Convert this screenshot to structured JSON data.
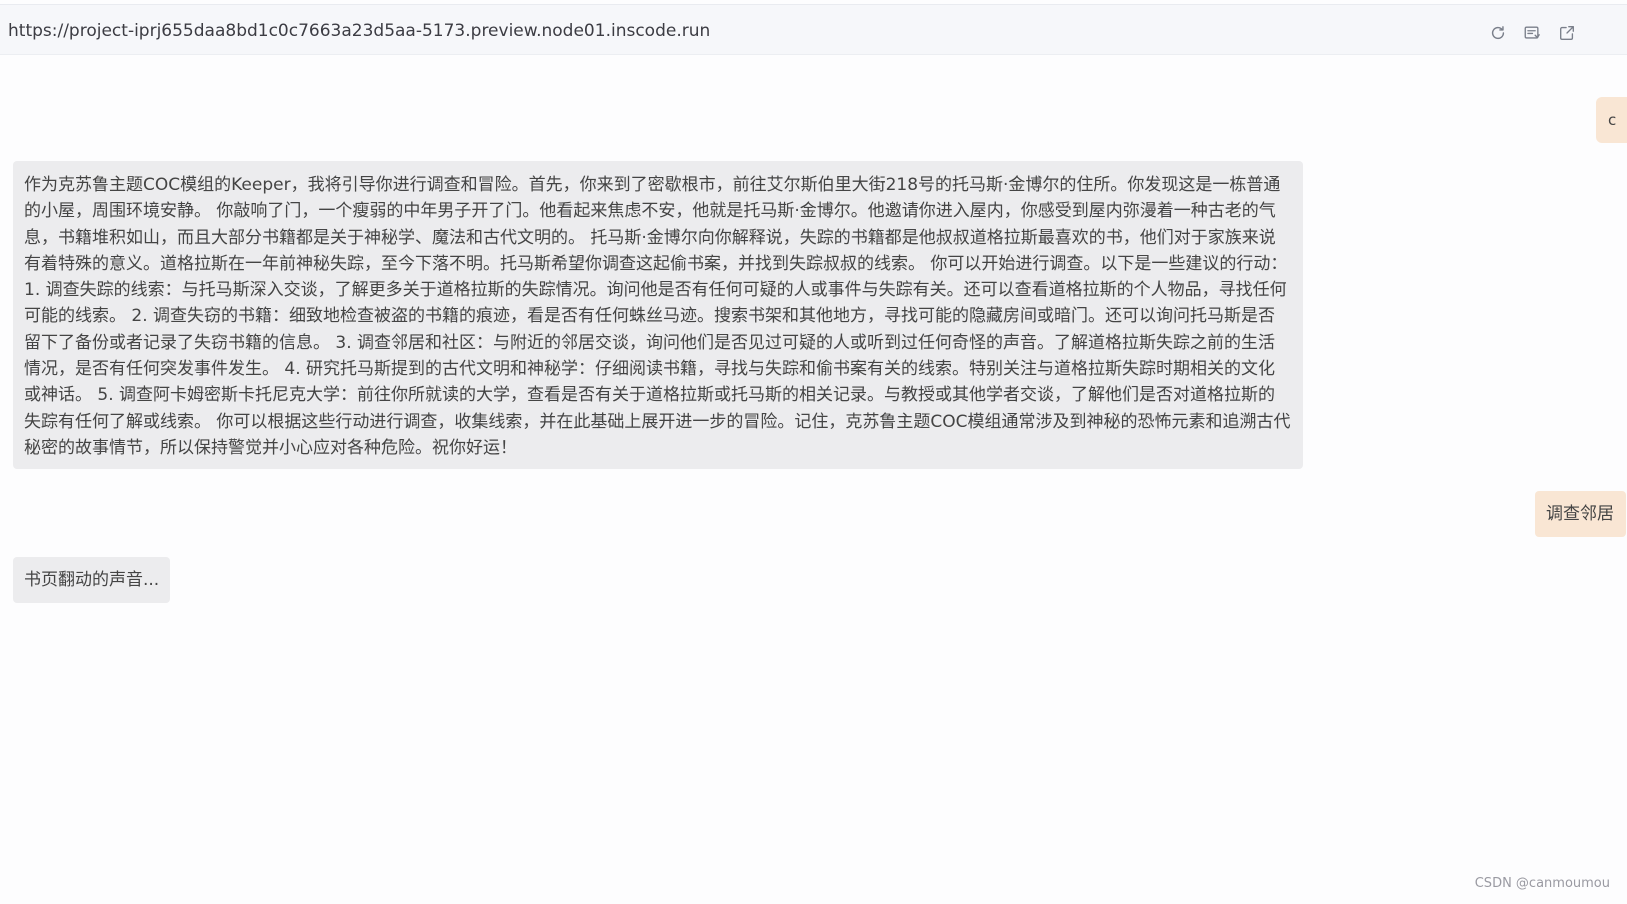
{
  "browser": {
    "url": "https://project-iprj655daa8bd1c0c7663a23d5aa-5173.preview.node01.inscode.run",
    "icons": [
      "refresh-icon",
      "reader-icon",
      "open-external-icon"
    ]
  },
  "chat": {
    "messages": [
      {
        "role": "user",
        "text": "c"
      },
      {
        "role": "assistant",
        "text": "作为克苏鲁主题COC模组的Keeper，我将引导你进行调查和冒险。首先，你来到了密歇根市，前往艾尔斯伯里大街218号的托马斯·金博尔的住所。你发现这是一栋普通的小屋，周围环境安静。 你敲响了门，一个瘦弱的中年男子开了门。他看起来焦虑不安，他就是托马斯·金博尔。他邀请你进入屋内，你感受到屋内弥漫着一种古老的气息，书籍堆积如山，而且大部分书籍都是关于神秘学、魔法和古代文明的。 托马斯·金博尔向你解释说，失踪的书籍都是他叔叔道格拉斯最喜欢的书，他们对于家族来说有着特殊的意义。道格拉斯在一年前神秘失踪，至今下落不明。托马斯希望你调查这起偷书案，并找到失踪叔叔的线索。 你可以开始进行调查。以下是一些建议的行动： 1. 调查失踪的线索：与托马斯深入交谈，了解更多关于道格拉斯的失踪情况。询问他是否有任何可疑的人或事件与失踪有关。还可以查看道格拉斯的个人物品，寻找任何可能的线索。 2. 调查失窃的书籍：细致地检查被盗的书籍的痕迹，看是否有任何蛛丝马迹。搜索书架和其他地方，寻找可能的隐藏房间或暗门。还可以询问托马斯是否留下了备份或者记录了失窃书籍的信息。 3. 调查邻居和社区：与附近的邻居交谈，询问他们是否见过可疑的人或听到过任何奇怪的声音。了解道格拉斯失踪之前的生活情况，是否有任何突发事件发生。 4. 研究托马斯提到的古代文明和神秘学：仔细阅读书籍，寻找与失踪和偷书案有关的线索。特别关注与道格拉斯失踪时期相关的文化或神话。 5. 调查阿卡姆密斯卡托尼克大学：前往你所就读的大学，查看是否有关于道格拉斯或托马斯的相关记录。与教授或其他学者交谈，了解他们是否对道格拉斯的失踪有任何了解或线索。 你可以根据这些行动进行调查，收集线索，并在此基础上展开进一步的冒险。记住，克苏鲁主题COC模组通常涉及到神秘的恐怖元素和追溯古代秘密的故事情节，所以保持警觉并小心应对各种危险。祝你好运！"
      },
      {
        "role": "user",
        "text": "调查邻居"
      },
      {
        "role": "assistant",
        "text": "书页翻动的声音..."
      }
    ]
  },
  "watermark": "CSDN @canmoumou",
  "colors": {
    "user_bubble": "#f9e6d4",
    "assistant_bubble": "#ececee",
    "url_bar": "#f6f7fa",
    "page_background": "#fdfdfe"
  }
}
